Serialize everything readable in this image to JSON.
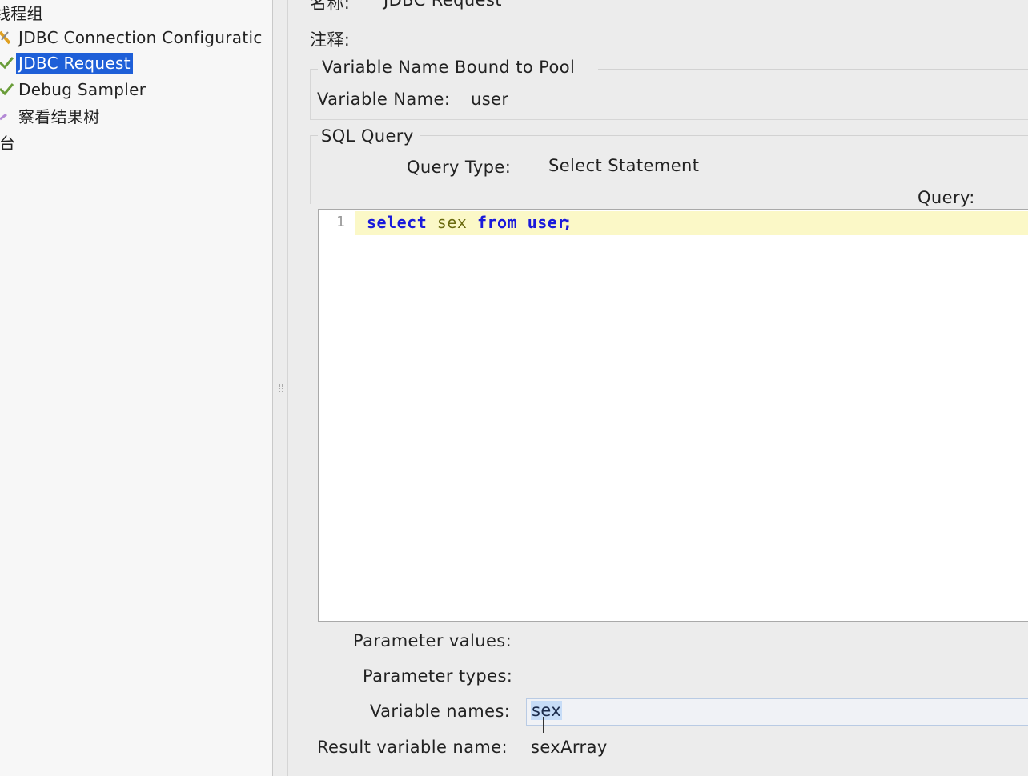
{
  "tree": {
    "items": [
      {
        "label": "线程组",
        "icon": "thread-group-icon"
      },
      {
        "label": "JDBC Connection Configuratic",
        "icon": "wrench-icon"
      },
      {
        "label": "JDBC Request",
        "icon": "sampler-check-icon",
        "selected": true
      },
      {
        "label": "Debug Sampler",
        "icon": "sampler-check-icon"
      },
      {
        "label": "察看结果树",
        "icon": "listener-icon"
      },
      {
        "label": "台",
        "icon": "workbench-icon"
      }
    ]
  },
  "form": {
    "name_label": "名称:",
    "name_value": "JDBC Request",
    "comment_label": "注释:",
    "pool_section": {
      "title": "Variable Name Bound to Pool",
      "var_label": "Variable Name:",
      "var_value": "user"
    },
    "sql_section": {
      "title": "SQL Query",
      "query_type_label": "Query Type:",
      "query_type_value": "Select Statement",
      "query_label": "Query:",
      "editor": {
        "line_number": "1",
        "tokens": [
          "select",
          "sex",
          "from",
          "user",
          ";"
        ]
      }
    },
    "param_values_label": "Parameter values:",
    "param_values_value": "",
    "param_types_label": "Parameter types:",
    "param_types_value": "",
    "var_names_label": "Variable names:",
    "var_names_value": "sex",
    "result_var_label": "Result variable name:",
    "result_var_value": "sexArray"
  },
  "colors": {
    "selection": "#1e5fd8",
    "keyword": "#1a1adb",
    "identifier": "#6b6b10",
    "current_line": "#fbf8c7"
  }
}
